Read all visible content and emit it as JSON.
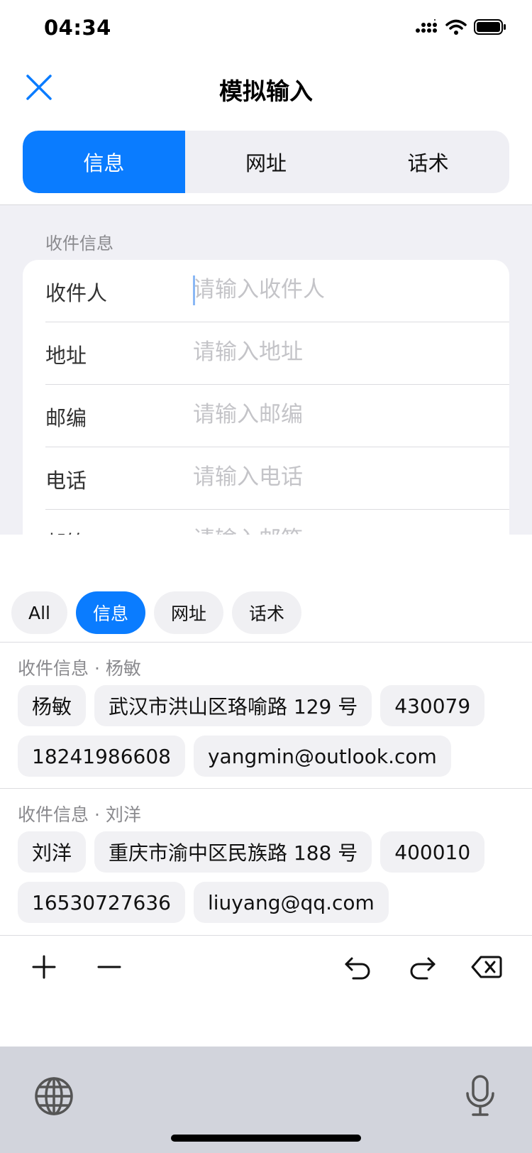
{
  "status": {
    "time": "04:34"
  },
  "header": {
    "title": "模拟输入"
  },
  "tabs": [
    {
      "label": "信息",
      "active": true
    },
    {
      "label": "网址",
      "active": false
    },
    {
      "label": "话术",
      "active": false
    }
  ],
  "form": {
    "section_label": "收件信息",
    "fields": [
      {
        "label": "收件人",
        "placeholder": "请输入收件人"
      },
      {
        "label": "地址",
        "placeholder": "请输入地址"
      },
      {
        "label": "邮编",
        "placeholder": "请输入邮编"
      },
      {
        "label": "电话",
        "placeholder": "请输入电话"
      },
      {
        "label": "邮箱",
        "placeholder": "请输入邮箱"
      }
    ]
  },
  "filters": [
    {
      "label": "All",
      "active": false
    },
    {
      "label": "信息",
      "active": true
    },
    {
      "label": "网址",
      "active": false
    },
    {
      "label": "话术",
      "active": false
    }
  ],
  "groups": [
    {
      "title": "收件信息 · 杨敏",
      "row1": [
        "杨敏",
        "武汉市洪山区珞喻路 129 号",
        "430079"
      ],
      "row2": [
        "18241986608",
        "yangmin@outlook.com"
      ]
    },
    {
      "title": "收件信息 · 刘洋",
      "row1": [
        "刘洋",
        "重庆市渝中区民族路 188 号",
        "400010"
      ],
      "row2": [
        "16530727636",
        "liuyang@qq.com"
      ]
    }
  ],
  "colors": {
    "accent": "#0a7cff",
    "form_bg": "#f0f0f5",
    "keyboard_bg": "#d2d4dc"
  }
}
